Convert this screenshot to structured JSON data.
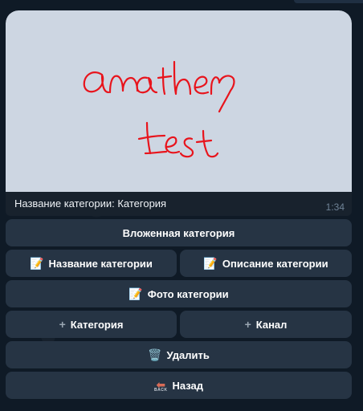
{
  "message": {
    "photo_text": [
      "another",
      "test"
    ],
    "caption": "Название категории: Категория",
    "time": "1:34"
  },
  "keyboard": {
    "nested_category": "Вложенная категория",
    "category_name": "Название категории",
    "category_description": "Описание категории",
    "category_photo": "Фото категории",
    "add_category": "Категория",
    "add_channel": "Канал",
    "delete": "Удалить",
    "back": "Назад",
    "back_icon_text": "BACK"
  },
  "icons": {
    "memo": "memo-icon",
    "plus": "plus-icon",
    "trash": "wastebasket-icon",
    "back": "back-arrow-icon"
  },
  "colors": {
    "chat_bg": "#0f1a26",
    "bubble": "#18222d",
    "button": "#283646",
    "ink": "#e8141c"
  }
}
